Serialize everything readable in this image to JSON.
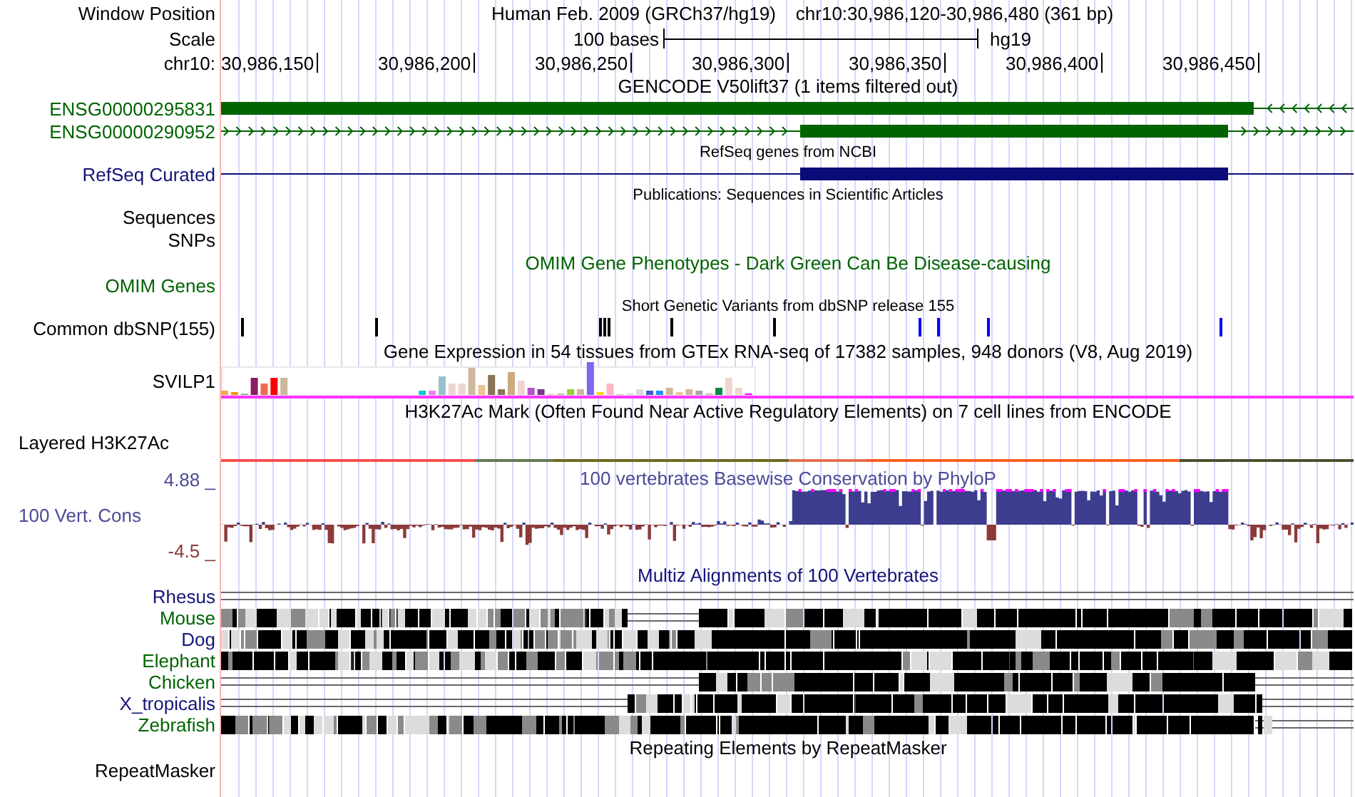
{
  "window_position": {
    "label": "Window Position",
    "assembly": "Human Feb. 2009 (GRCh37/hg19)",
    "position": "chr10:30,986,120-30,986,480 (361 bp)"
  },
  "scale": {
    "label": "Scale",
    "length": "100 bases",
    "assembly": "hg19"
  },
  "ruler": {
    "label": "chr10:",
    "ticks": [
      "30,986,150",
      "30,986,200",
      "30,986,250",
      "30,986,300",
      "30,986,350",
      "30,986,400",
      "30,986,450"
    ]
  },
  "tracks": [
    {
      "kind": "title",
      "title": "GENCODE V50lift37 (1 items filtered out)"
    },
    {
      "kind": "gene",
      "label": "ENSG00000295831",
      "color": "#006400"
    },
    {
      "kind": "gene",
      "label": "ENSG00000290952",
      "color": "#006400"
    },
    {
      "kind": "subtitle",
      "title": "RefSeq genes from NCBI"
    },
    {
      "kind": "gene",
      "label": "RefSeq Curated",
      "color": "#141478"
    },
    {
      "kind": "subtitle",
      "title": "Publications: Sequences in Scientific Articles"
    },
    {
      "kind": "label",
      "label": "Sequences"
    },
    {
      "kind": "label",
      "label": "SNPs"
    },
    {
      "kind": "title",
      "title": "OMIM Gene Phenotypes - Dark Green Can Be Disease-causing",
      "color": "#006400"
    },
    {
      "kind": "label",
      "label": "OMIM Genes",
      "color": "#006400"
    },
    {
      "kind": "subtitle",
      "title": "Short Genetic Variants from dbSNP release 155"
    },
    {
      "kind": "snp",
      "label": "Common dbSNP(155)"
    },
    {
      "kind": "title",
      "title": "Gene Expression in 54 tissues from GTEx RNA-seq of 17382 samples, 948 donors (V8, Aug 2019)"
    },
    {
      "kind": "expression",
      "label": "SVILP1"
    },
    {
      "kind": "title",
      "title": "H3K27Ac Mark (Often Found Near Active Regulatory Elements) on 7 cell lines from ENCODE"
    },
    {
      "kind": "layered",
      "label": "Layered H3K27Ac"
    },
    {
      "kind": "conservation",
      "label": "100 Vert. Cons",
      "title": "100 vertebrates Basewise Conservation by PhyloP",
      "upper": "4.88 _",
      "lower": "-4.5 _",
      "color": "#4b4b96"
    },
    {
      "kind": "title",
      "title": "Multiz Alignments of 100 Vertebrates",
      "color": "#141478"
    },
    {
      "kind": "species",
      "label": "Rhesus",
      "color": "#141478"
    },
    {
      "kind": "species",
      "label": "Mouse",
      "color": "#006400"
    },
    {
      "kind": "species",
      "label": "Dog",
      "color": "#141478"
    },
    {
      "kind": "species",
      "label": "Elephant",
      "color": "#006400"
    },
    {
      "kind": "species",
      "label": "Chicken",
      "color": "#006400"
    },
    {
      "kind": "species",
      "label": "X_tropicalis",
      "color": "#141478"
    },
    {
      "kind": "species",
      "label": "Zebrafish",
      "color": "#006400"
    },
    {
      "kind": "title",
      "title": "Repeating Elements by RepeatMasker"
    },
    {
      "kind": "label",
      "label": "RepeatMasker"
    }
  ]
}
